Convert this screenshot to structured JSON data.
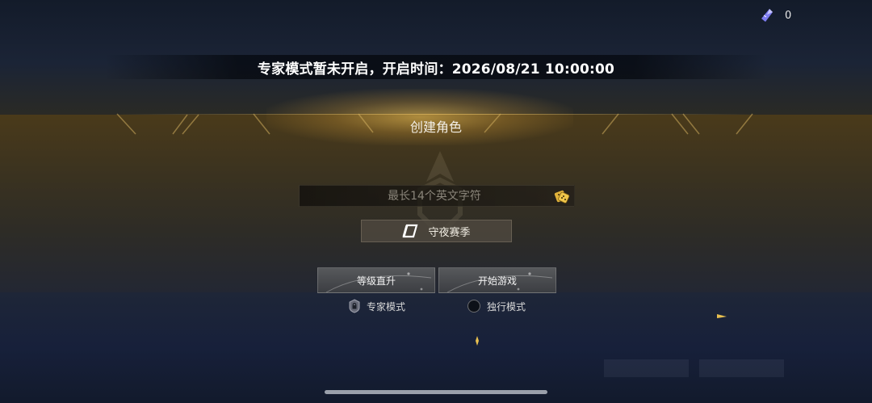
{
  "currency": {
    "icon": "gem-icon",
    "value": "0"
  },
  "notice": {
    "text": "专家模式暂未开启，开启时间：2026/08/21 10:00:00"
  },
  "title": "创建角色",
  "name_input": {
    "value": "",
    "placeholder": "最长14个英文字符"
  },
  "season_button": {
    "label": "守夜赛季"
  },
  "buttons": {
    "level_up": "等级直升",
    "start_game": "开始游戏"
  },
  "modes": {
    "expert": "专家模式",
    "solo": "独行模式"
  },
  "colors": {
    "gold": "#e8b84a",
    "dice": "#e0b23a",
    "gem": "#7d7cf0"
  }
}
